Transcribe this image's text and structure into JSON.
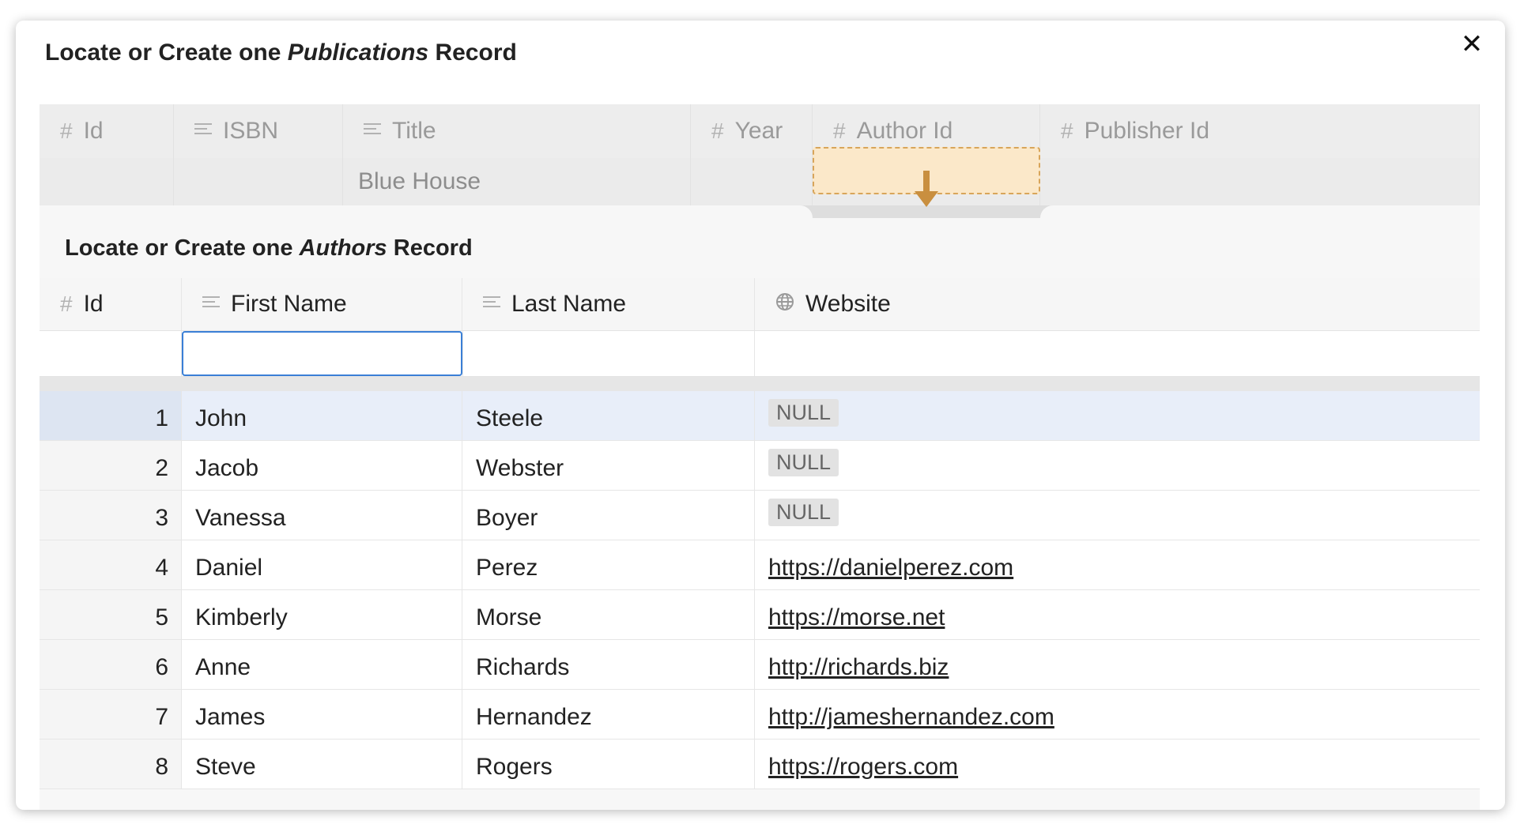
{
  "modal": {
    "title_prefix": "Locate or Create one ",
    "title_table": "Publications",
    "title_suffix": " Record",
    "close_label": "✕"
  },
  "parent_grid": {
    "columns": [
      {
        "name": "Id",
        "icon": "hash-icon"
      },
      {
        "name": "ISBN",
        "icon": "text-lines-icon"
      },
      {
        "name": "Title",
        "icon": "text-lines-icon"
      },
      {
        "name": "Year",
        "icon": "hash-icon"
      },
      {
        "name": "Author Id",
        "icon": "hash-icon"
      },
      {
        "name": "Publisher Id",
        "icon": "hash-icon"
      }
    ],
    "row": [
      "",
      "",
      "Blue House",
      "",
      "",
      ""
    ]
  },
  "child": {
    "title_prefix": "Locate or Create one ",
    "title_table": "Authors",
    "title_suffix": " Record",
    "columns": [
      {
        "name": "Id",
        "icon": "hash-icon"
      },
      {
        "name": "First Name",
        "icon": "text-lines-icon"
      },
      {
        "name": "Last Name",
        "icon": "text-lines-icon"
      },
      {
        "name": "Website",
        "icon": "globe-icon"
      }
    ],
    "filter": {
      "first_name": "",
      "placeholder": ""
    },
    "null_label": "NULL",
    "rows": [
      {
        "id": "1",
        "first": "John",
        "last": "Steele",
        "website": null
      },
      {
        "id": "2",
        "first": "Jacob",
        "last": "Webster",
        "website": null
      },
      {
        "id": "3",
        "first": "Vanessa",
        "last": "Boyer",
        "website": null
      },
      {
        "id": "4",
        "first": "Daniel",
        "last": "Perez",
        "website": "https://danielperez.com"
      },
      {
        "id": "5",
        "first": "Kimberly",
        "last": "Morse",
        "website": "https://morse.net"
      },
      {
        "id": "6",
        "first": "Anne",
        "last": "Richards",
        "website": "http://richards.biz"
      },
      {
        "id": "7",
        "first": "James",
        "last": "Hernandez",
        "website": "http://jameshernandez.com"
      },
      {
        "id": "8",
        "first": "Steve",
        "last": "Rogers",
        "website": "https://rogers.com"
      }
    ]
  },
  "colors": {
    "selected_row": "#e8eef9",
    "drop_target": "#fbe8c9",
    "drop_target_border": "#d8a55a",
    "focus_border": "#3a7fd6"
  }
}
